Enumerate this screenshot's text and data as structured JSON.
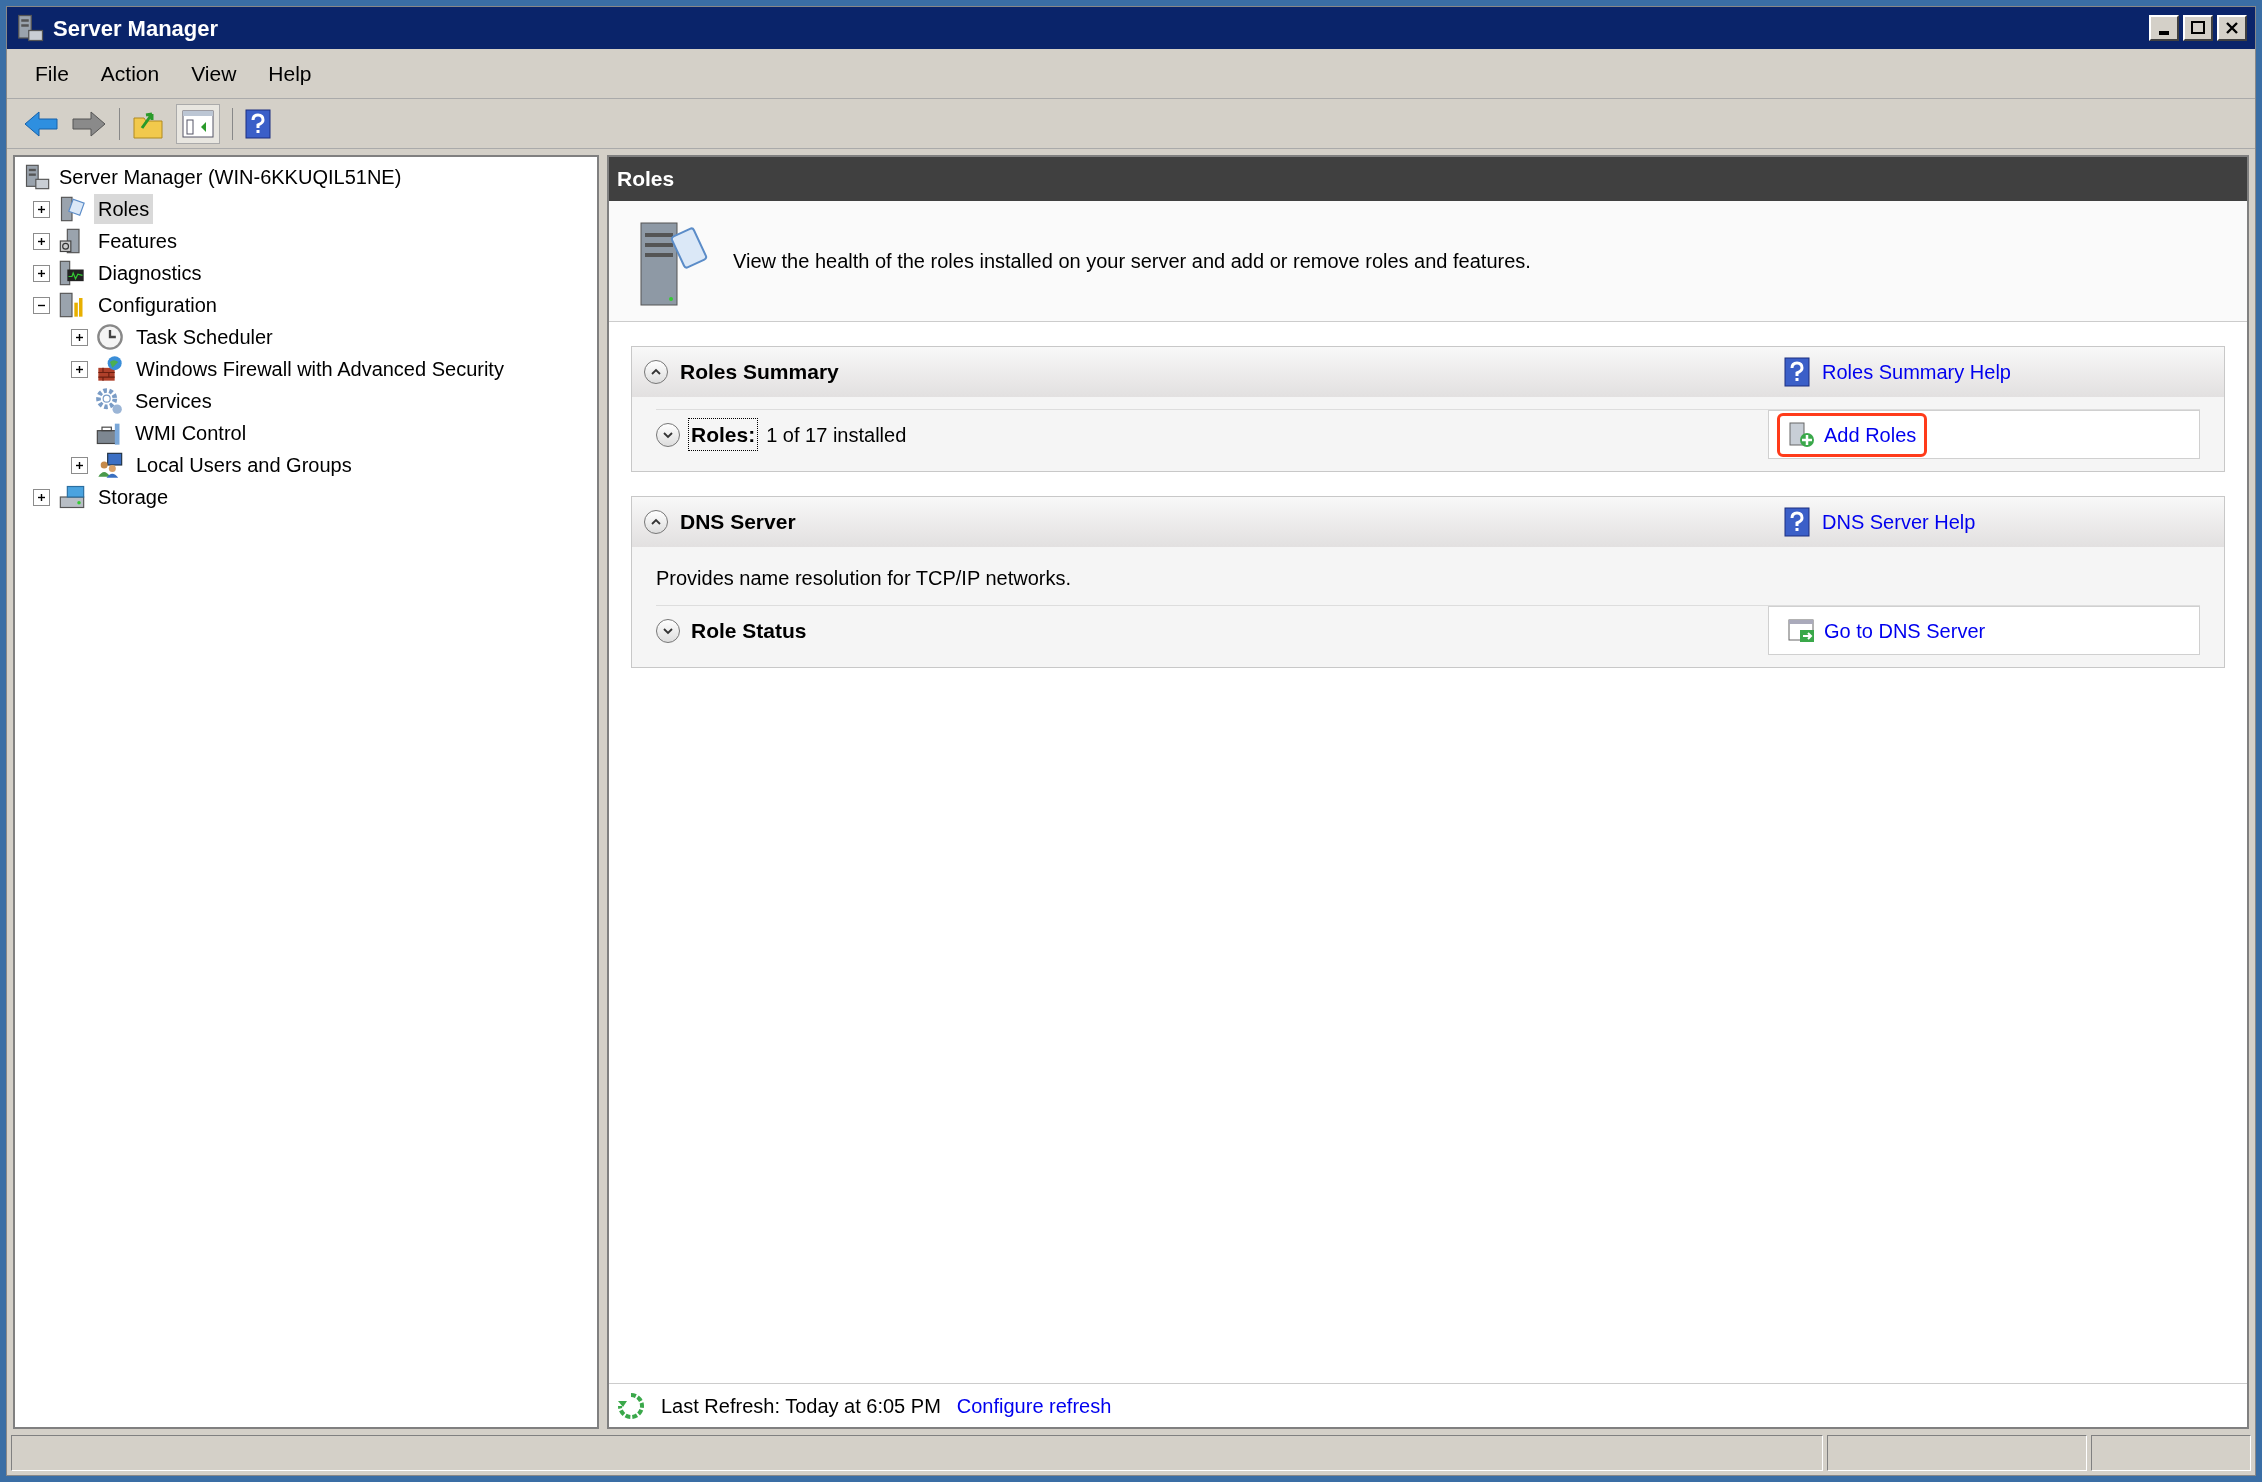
{
  "window": {
    "title": "Server Manager"
  },
  "menu": [
    "File",
    "Action",
    "View",
    "Help"
  ],
  "tree": {
    "label": "Server Manager (WIN-6KKUQIL51NE)",
    "children": [
      {
        "label": "Roles",
        "expanded": false,
        "selected": true
      },
      {
        "label": "Features",
        "expanded": false,
        "selected": false
      },
      {
        "label": "Diagnostics",
        "expanded": false,
        "selected": false
      },
      {
        "label": "Configuration",
        "expanded": true,
        "selected": false,
        "children": [
          {
            "label": "Task Scheduler",
            "expanded": false,
            "selected": false
          },
          {
            "label": "Windows Firewall with Advanced Security",
            "expanded": false,
            "selected": false
          },
          {
            "label": "Services",
            "selected": false
          },
          {
            "label": "WMI Control",
            "selected": false
          },
          {
            "label": "Local Users and Groups",
            "expanded": false,
            "selected": false
          }
        ]
      },
      {
        "label": "Storage",
        "expanded": false,
        "selected": false
      }
    ]
  },
  "content": {
    "title": "Roles",
    "description": "View the health of the roles installed on your server and add or remove roles and features.",
    "sections": [
      {
        "title": "Roles Summary",
        "expanded": true,
        "help_link": "Roles Summary Help",
        "rows": [
          {
            "label": "Roles:",
            "label_focused": true,
            "value": "1 of 17 installed",
            "expanded": false,
            "action": "Add Roles",
            "action_highlighted": true
          }
        ]
      },
      {
        "title": "DNS Server",
        "expanded": true,
        "help_link": "DNS Server Help",
        "description": "Provides name resolution for TCP/IP networks.",
        "rows": [
          {
            "label": "Role Status",
            "label_focused": false,
            "expanded": false,
            "action": "Go to DNS Server",
            "action_highlighted": false
          }
        ]
      }
    ]
  },
  "refresh": {
    "text": "Last Refresh: Today at 6:05 PM",
    "link": "Configure refresh"
  }
}
